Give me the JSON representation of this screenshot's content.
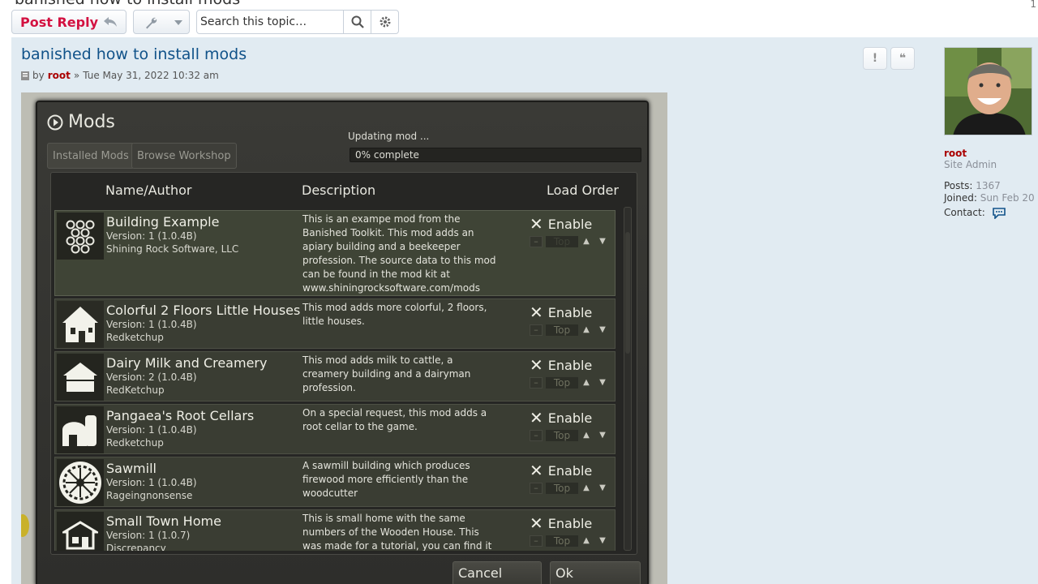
{
  "header": {
    "cut_title": "banished how to install mods"
  },
  "toolbar": {
    "reply_label": "Post Reply",
    "search_placeholder": "Search this topic…"
  },
  "post": {
    "title": "banished how to install mods",
    "meta_by": "by",
    "meta_author": "root",
    "meta_sep": "»",
    "meta_date": "Tue May 31, 2022 10:32 am",
    "report_label": "!",
    "quote_label": "❝"
  },
  "profile": {
    "username": "root",
    "rank": "Site Admin",
    "posts_label": "Posts:",
    "posts_value": "1367",
    "joined_label": "Joined:",
    "joined_value": "Sun Feb 20",
    "contact_label": "Contact:"
  },
  "game": {
    "panel_title": "Mods",
    "tab_installed": "Installed Mods",
    "tab_browse": "Browse Workshop",
    "update_label": "Updating mod ...",
    "update_progress": "0% complete",
    "col_name": "Name/Author",
    "col_desc": "Description",
    "col_order": "Load Order",
    "cancel_label": "Cancel",
    "ok_label": "Ok",
    "mods": [
      {
        "name": "Building Example",
        "version": "Version: 1 (1.0.4B)",
        "author": "Shining Rock Software, LLC",
        "desc": "This is an exampe mod from the Banished Toolkit. This mod adds an apiary building and a beekeeper profession. The source data to this mod can be found in the mod kit at www.shiningrocksoftware.com/mods",
        "enable": "Enable",
        "order": "Top"
      },
      {
        "name": "Colorful 2 Floors Little Houses",
        "version": "Version: 1 (1.0.4B)",
        "author": "Redketchup",
        "desc": "This mod adds more colorful, 2 floors, little houses.",
        "enable": "Enable",
        "order": "Top"
      },
      {
        "name": "Dairy Milk and Creamery",
        "version": "Version: 2 (1.0.4B)",
        "author": "RedKetchup",
        "desc": "This mod adds milk to cattle, a creamery building and a dairyman profession.",
        "enable": "Enable",
        "order": "Top"
      },
      {
        "name": "Pangaea's Root Cellars",
        "version": "Version: 1 (1.0.4B)",
        "author": "Redketchup",
        "desc": "On a special request, this mod adds a root cellar to the game.",
        "enable": "Enable",
        "order": "Top"
      },
      {
        "name": "Sawmill",
        "version": "Version: 1 (1.0.4B)",
        "author": "Rageingnonsense",
        "desc": "A sawmill building which produces firewood more efficiently than the woodcutter",
        "enable": "Enable",
        "order": "Top"
      },
      {
        "name": "Small Town Home",
        "version": "Version: 1 (1.0.7)",
        "author": "Discrepancy",
        "desc": "This is small home with the same numbers of the Wooden House. This was made for a tutorial, you can find it",
        "enable": "Enable",
        "order": "Top"
      }
    ]
  }
}
